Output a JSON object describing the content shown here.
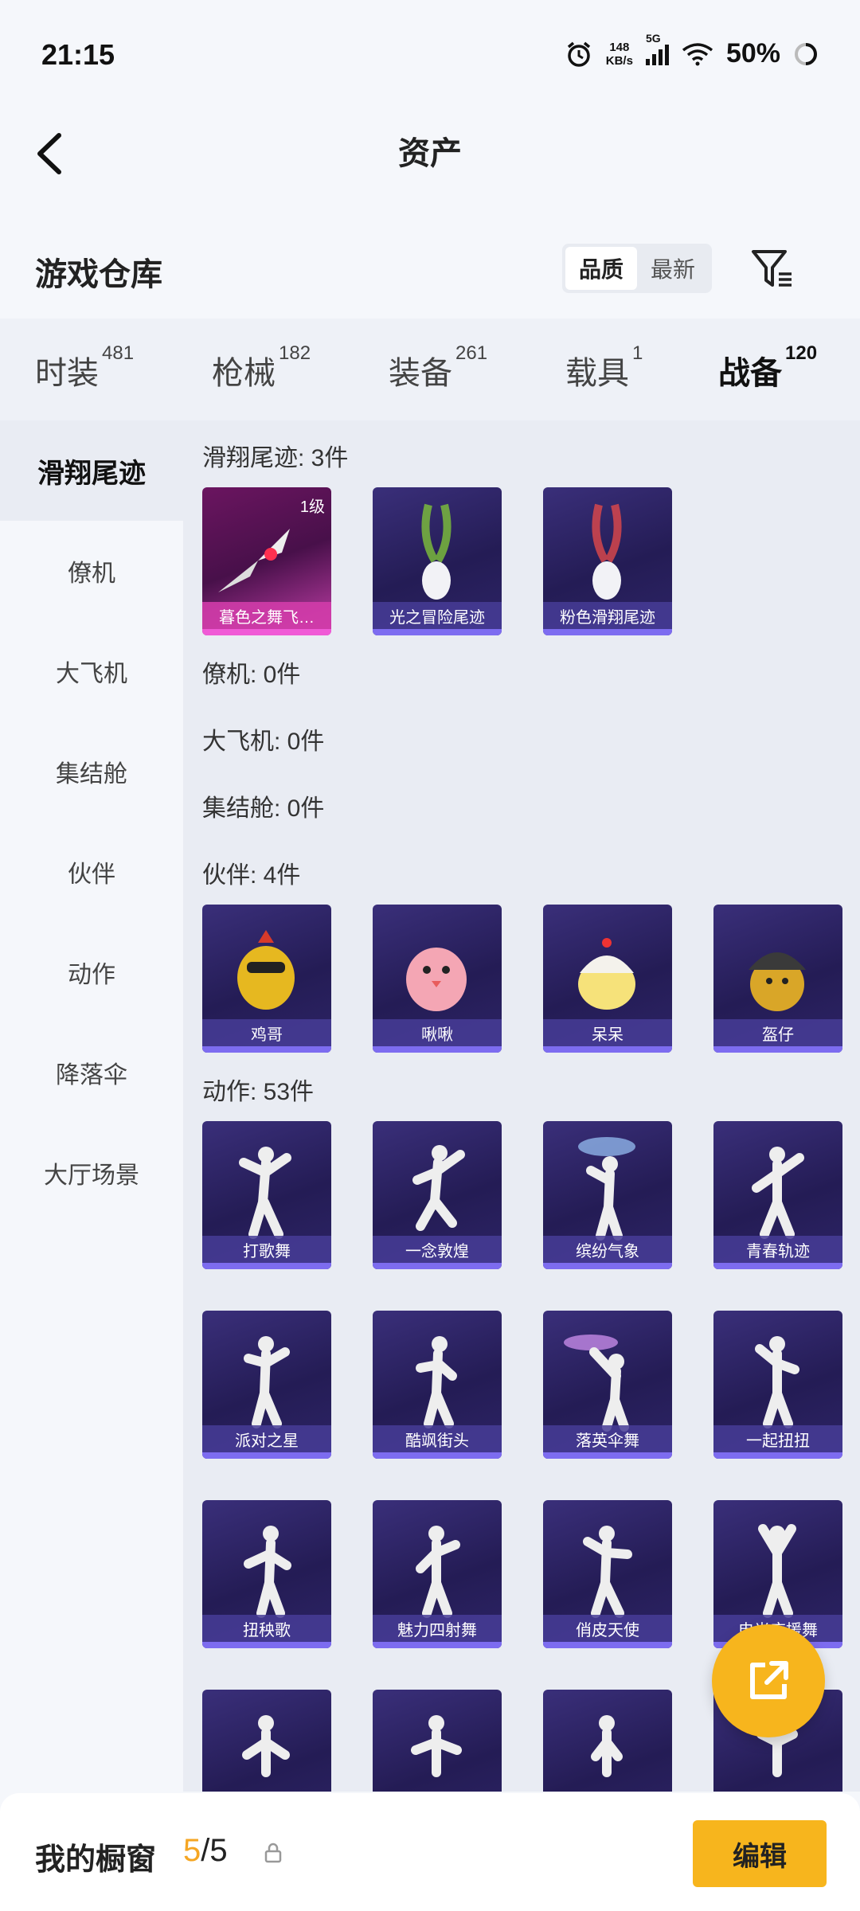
{
  "status": {
    "time": "21:15",
    "speed_value": "148",
    "speed_unit": "KB/s",
    "network": "5G",
    "battery": "50%"
  },
  "nav": {
    "title": "资产"
  },
  "warehouse": {
    "title": "游戏仓库",
    "sort_options": [
      "品质",
      "最新"
    ],
    "sort_selected": "品质"
  },
  "tabs": [
    {
      "label": "时装",
      "count": "481"
    },
    {
      "label": "枪械",
      "count": "182"
    },
    {
      "label": "装备",
      "count": "261"
    },
    {
      "label": "载具",
      "count": "1"
    },
    {
      "label": "战备",
      "count": "120",
      "active": true
    }
  ],
  "sidebar": [
    {
      "label": "滑翔尾迹",
      "active": true
    },
    {
      "label": "僚机"
    },
    {
      "label": "大飞机"
    },
    {
      "label": "集结舱"
    },
    {
      "label": "伙伴"
    },
    {
      "label": "动作"
    },
    {
      "label": "降落伞"
    },
    {
      "label": "大厅场景"
    }
  ],
  "sections": {
    "glide": {
      "title": "滑翔尾迹: 3件",
      "items": [
        {
          "label": "暮色之舞飞…",
          "level": "1级",
          "style": "magenta"
        },
        {
          "label": "光之冒险尾迹",
          "trail_color": "#7ec23a"
        },
        {
          "label": "粉色滑翔尾迹",
          "trail_color": "#e0484a"
        }
      ]
    },
    "wingman": {
      "title": "僚机: 0件"
    },
    "plane": {
      "title": "大飞机: 0件"
    },
    "pod": {
      "title": "集结舱: 0件"
    },
    "partner": {
      "title": "伙伴: 4件",
      "items": [
        {
          "label": "鸡哥"
        },
        {
          "label": "啾啾"
        },
        {
          "label": "呆呆"
        },
        {
          "label": "盔仔"
        }
      ]
    },
    "emote": {
      "title": "动作: 53件",
      "items": [
        {
          "label": "打歌舞"
        },
        {
          "label": "一念敦煌"
        },
        {
          "label": "缤纷气象"
        },
        {
          "label": "青春轨迹"
        },
        {
          "label": "派对之星"
        },
        {
          "label": "酷飒街头"
        },
        {
          "label": "落英伞舞"
        },
        {
          "label": "一起扭扭"
        },
        {
          "label": "扭秧歌"
        },
        {
          "label": "魅力四射舞"
        },
        {
          "label": "俏皮天使"
        },
        {
          "label": "电光应援舞"
        },
        {
          "label": ""
        },
        {
          "label": ""
        },
        {
          "label": ""
        },
        {
          "label": ""
        }
      ]
    }
  },
  "bottom": {
    "label": "我的橱窗",
    "count_current": "5",
    "count_sep": "/5",
    "edit": "编辑"
  },
  "colors": {
    "accent": "#f5a623",
    "fab": "#f7b51d",
    "card_bg": "#2d2466"
  }
}
